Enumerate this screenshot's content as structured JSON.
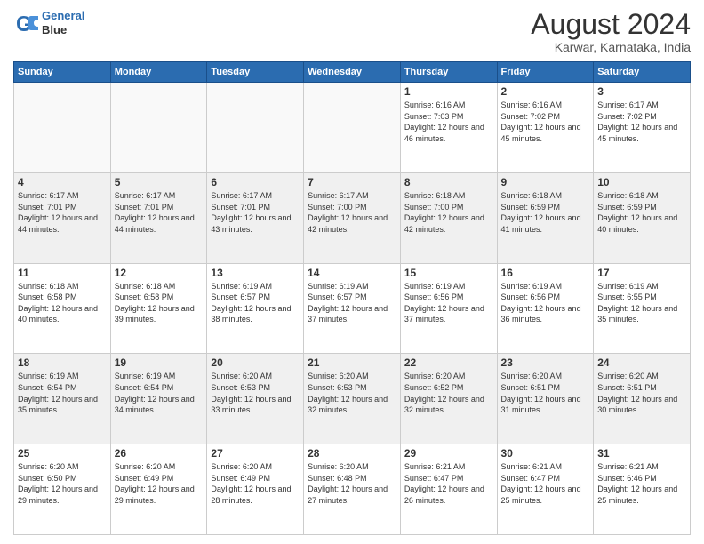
{
  "header": {
    "logo_line1": "General",
    "logo_line2": "Blue",
    "month": "August 2024",
    "location": "Karwar, Karnataka, India"
  },
  "weekdays": [
    "Sunday",
    "Monday",
    "Tuesday",
    "Wednesday",
    "Thursday",
    "Friday",
    "Saturday"
  ],
  "weeks": [
    [
      {
        "day": "",
        "info": ""
      },
      {
        "day": "",
        "info": ""
      },
      {
        "day": "",
        "info": ""
      },
      {
        "day": "",
        "info": ""
      },
      {
        "day": "1",
        "info": "Sunrise: 6:16 AM\nSunset: 7:03 PM\nDaylight: 12 hours and 46 minutes."
      },
      {
        "day": "2",
        "info": "Sunrise: 6:16 AM\nSunset: 7:02 PM\nDaylight: 12 hours and 45 minutes."
      },
      {
        "day": "3",
        "info": "Sunrise: 6:17 AM\nSunset: 7:02 PM\nDaylight: 12 hours and 45 minutes."
      }
    ],
    [
      {
        "day": "4",
        "info": "Sunrise: 6:17 AM\nSunset: 7:01 PM\nDaylight: 12 hours and 44 minutes."
      },
      {
        "day": "5",
        "info": "Sunrise: 6:17 AM\nSunset: 7:01 PM\nDaylight: 12 hours and 44 minutes."
      },
      {
        "day": "6",
        "info": "Sunrise: 6:17 AM\nSunset: 7:01 PM\nDaylight: 12 hours and 43 minutes."
      },
      {
        "day": "7",
        "info": "Sunrise: 6:17 AM\nSunset: 7:00 PM\nDaylight: 12 hours and 42 minutes."
      },
      {
        "day": "8",
        "info": "Sunrise: 6:18 AM\nSunset: 7:00 PM\nDaylight: 12 hours and 42 minutes."
      },
      {
        "day": "9",
        "info": "Sunrise: 6:18 AM\nSunset: 6:59 PM\nDaylight: 12 hours and 41 minutes."
      },
      {
        "day": "10",
        "info": "Sunrise: 6:18 AM\nSunset: 6:59 PM\nDaylight: 12 hours and 40 minutes."
      }
    ],
    [
      {
        "day": "11",
        "info": "Sunrise: 6:18 AM\nSunset: 6:58 PM\nDaylight: 12 hours and 40 minutes."
      },
      {
        "day": "12",
        "info": "Sunrise: 6:18 AM\nSunset: 6:58 PM\nDaylight: 12 hours and 39 minutes."
      },
      {
        "day": "13",
        "info": "Sunrise: 6:19 AM\nSunset: 6:57 PM\nDaylight: 12 hours and 38 minutes."
      },
      {
        "day": "14",
        "info": "Sunrise: 6:19 AM\nSunset: 6:57 PM\nDaylight: 12 hours and 37 minutes."
      },
      {
        "day": "15",
        "info": "Sunrise: 6:19 AM\nSunset: 6:56 PM\nDaylight: 12 hours and 37 minutes."
      },
      {
        "day": "16",
        "info": "Sunrise: 6:19 AM\nSunset: 6:56 PM\nDaylight: 12 hours and 36 minutes."
      },
      {
        "day": "17",
        "info": "Sunrise: 6:19 AM\nSunset: 6:55 PM\nDaylight: 12 hours and 35 minutes."
      }
    ],
    [
      {
        "day": "18",
        "info": "Sunrise: 6:19 AM\nSunset: 6:54 PM\nDaylight: 12 hours and 35 minutes."
      },
      {
        "day": "19",
        "info": "Sunrise: 6:19 AM\nSunset: 6:54 PM\nDaylight: 12 hours and 34 minutes."
      },
      {
        "day": "20",
        "info": "Sunrise: 6:20 AM\nSunset: 6:53 PM\nDaylight: 12 hours and 33 minutes."
      },
      {
        "day": "21",
        "info": "Sunrise: 6:20 AM\nSunset: 6:53 PM\nDaylight: 12 hours and 32 minutes."
      },
      {
        "day": "22",
        "info": "Sunrise: 6:20 AM\nSunset: 6:52 PM\nDaylight: 12 hours and 32 minutes."
      },
      {
        "day": "23",
        "info": "Sunrise: 6:20 AM\nSunset: 6:51 PM\nDaylight: 12 hours and 31 minutes."
      },
      {
        "day": "24",
        "info": "Sunrise: 6:20 AM\nSunset: 6:51 PM\nDaylight: 12 hours and 30 minutes."
      }
    ],
    [
      {
        "day": "25",
        "info": "Sunrise: 6:20 AM\nSunset: 6:50 PM\nDaylight: 12 hours and 29 minutes."
      },
      {
        "day": "26",
        "info": "Sunrise: 6:20 AM\nSunset: 6:49 PM\nDaylight: 12 hours and 29 minutes."
      },
      {
        "day": "27",
        "info": "Sunrise: 6:20 AM\nSunset: 6:49 PM\nDaylight: 12 hours and 28 minutes."
      },
      {
        "day": "28",
        "info": "Sunrise: 6:20 AM\nSunset: 6:48 PM\nDaylight: 12 hours and 27 minutes."
      },
      {
        "day": "29",
        "info": "Sunrise: 6:21 AM\nSunset: 6:47 PM\nDaylight: 12 hours and 26 minutes."
      },
      {
        "day": "30",
        "info": "Sunrise: 6:21 AM\nSunset: 6:47 PM\nDaylight: 12 hours and 25 minutes."
      },
      {
        "day": "31",
        "info": "Sunrise: 6:21 AM\nSunset: 6:46 PM\nDaylight: 12 hours and 25 minutes."
      }
    ]
  ]
}
